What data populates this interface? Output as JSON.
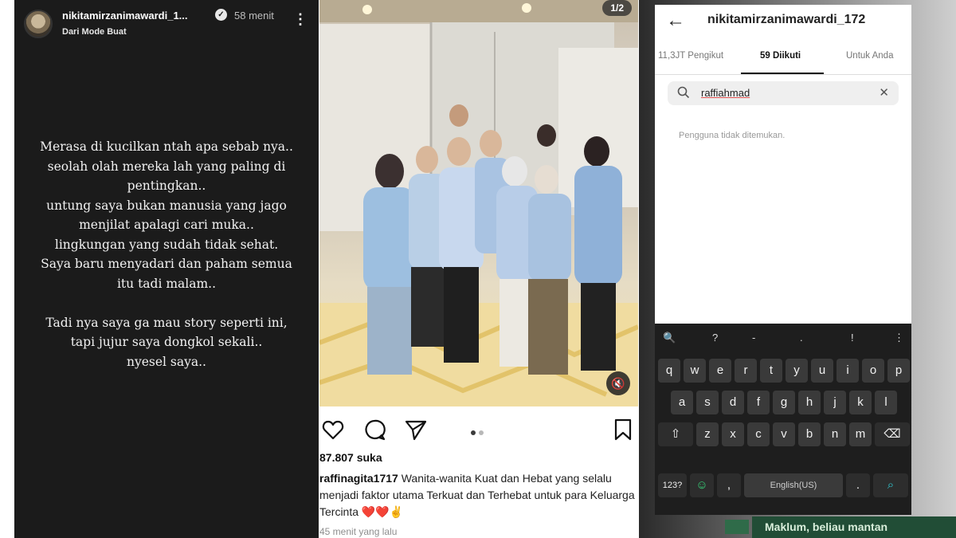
{
  "story": {
    "username": "nikitamirzanimawardi_1...",
    "time": "58 menit",
    "subtitle": "Dari Mode Buat",
    "lines": [
      "Merasa di kucilkan ntah apa sebab nya..",
      "seolah olah mereka lah yang paling di",
      "pentingkan..",
      "untung saya bukan manusia yang jago",
      "menjilat apalagi cari muka..",
      "lingkungan yang sudah tidak sehat.",
      "Saya baru menyadari dan paham semua",
      "itu tadi malam..",
      "",
      "Tadi nya saya ga mau story seperti ini,",
      "tapi jujur saya dongkol sekali..",
      "nyesel saya.."
    ]
  },
  "post": {
    "counter": "1/2",
    "likes": "87.807 suka",
    "caption_user": "raffinagita1717",
    "caption_text": " Wanita-wanita Kuat dan Hebat yang selalu menjadi faktor utama Terkuat dan Terhebat untuk para Keluarga Tercinta ",
    "caption_emoji": "❤️❤️✌",
    "time": "45 menit yang lalu"
  },
  "phone": {
    "username": "nikitamirzanimawardi_172",
    "tabs": [
      "11,3JT Pengikut",
      "59 Diikuti",
      "Untuk Anda"
    ],
    "active_tab": "59 Diikuti",
    "search_value": "raffiahmad",
    "empty_message": "Pengguna tidak ditemukan.",
    "keyboard": {
      "top_row": [
        "?",
        "-",
        ".",
        "!",
        "⋮"
      ],
      "row1": [
        "q",
        "w",
        "e",
        "r",
        "t",
        "y",
        "u",
        "i",
        "o",
        "p"
      ],
      "row2": [
        "a",
        "s",
        "d",
        "f",
        "g",
        "h",
        "j",
        "k",
        "l"
      ],
      "row3": [
        "z",
        "x",
        "c",
        "v",
        "b",
        "n",
        "m"
      ],
      "num_key": "123?",
      "space_label": "English(US)",
      "comma": ",",
      "period": "."
    }
  },
  "banner": {
    "text": "Maklum, beliau mantan"
  },
  "colors": {
    "story_bg": "#1b1b1b",
    "heart": "#e0262e",
    "keyboard_bg": "#1e1e1e",
    "banner_bg": "#214d36"
  }
}
